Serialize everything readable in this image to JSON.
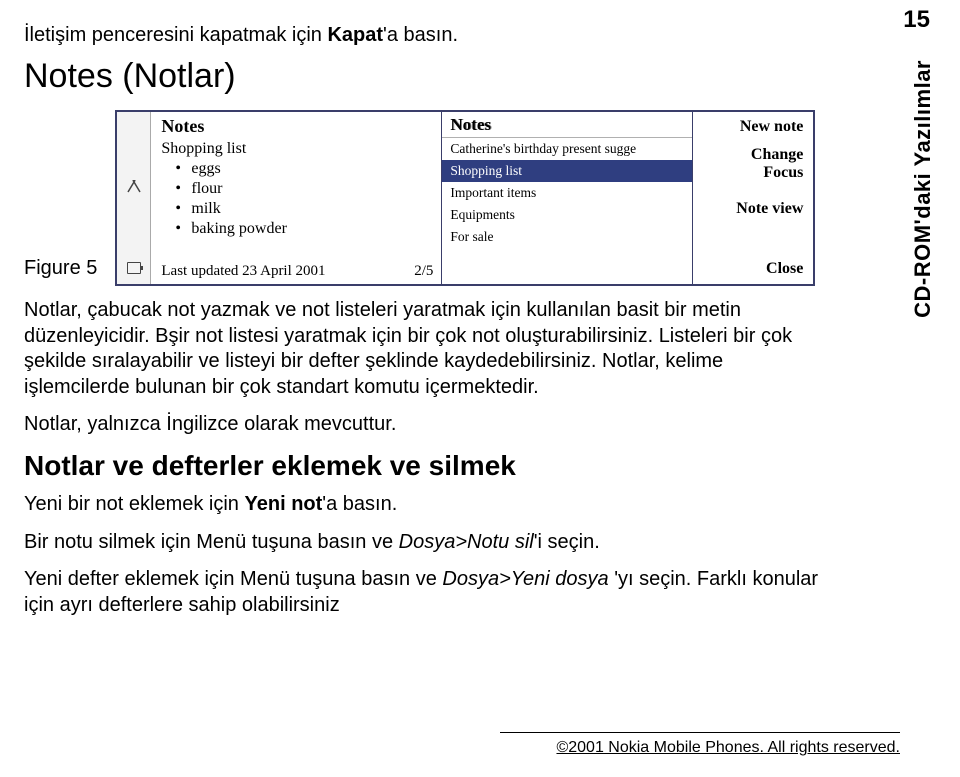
{
  "page_number": "15",
  "side_label": "CD-ROM'daki Yazılımlar",
  "intro_prefix": "İletişim penceresini kapatmak için ",
  "intro_strong": "Kapat",
  "intro_suffix": "'a basın.",
  "section_title": "Notes (Notlar)",
  "figure_label": "Figure 5",
  "screen": {
    "left": {
      "title": "Notes",
      "list_item": "Shopping list",
      "bullets": [
        "eggs",
        "flour",
        "milk",
        "baking powder"
      ],
      "footer_left": "Last updated 23 April 2001",
      "footer_right": "2/5"
    },
    "mid": {
      "header": "Notes",
      "rows": [
        "Catherine's birthday present sugge",
        "Shopping list",
        "Important items",
        "Equipments",
        "For sale"
      ],
      "selected_index": 1
    },
    "right": {
      "new_note": "New note",
      "change": "Change",
      "focus": "Focus",
      "note_view": "Note view",
      "close": "Close"
    }
  },
  "para1": "Notlar, çabucak not yazmak ve not listeleri yaratmak için kullanılan basit bir metin düzenleyicidir. Bşir not listesi yaratmak için bir çok not oluşturabilirsiniz. Listeleri bir çok şekilde sıralayabilir ve listeyi bir defter şeklinde kaydedebilirsiniz. Notlar, kelime işlemcilerde bulunan bir çok standart komutu içermektedir.",
  "para2": "Notlar, yalnızca İngilizce olarak mevcuttur.",
  "subsection": "Notlar ve defterler eklemek ve silmek",
  "p3_pre": "Yeni bir not eklemek için ",
  "p3_b": "Yeni not",
  "p3_post": "'a basın.",
  "p4_pre": "Bir notu silmek için Menü tuşuna basın ve ",
  "p4_em": "Dosya>Notu sil",
  "p4_post": "'i seçin.",
  "p5_pre": "Yeni defter eklemek için Menü tuşuna basın ve ",
  "p5_em": "Dosya>Yeni dosya ",
  "p5_post": "'yı seçin. Farklı konular için ayrı defterlere sahip olabilirsiniz",
  "footer": "©2001 Nokia Mobile Phones. All rights reserved."
}
